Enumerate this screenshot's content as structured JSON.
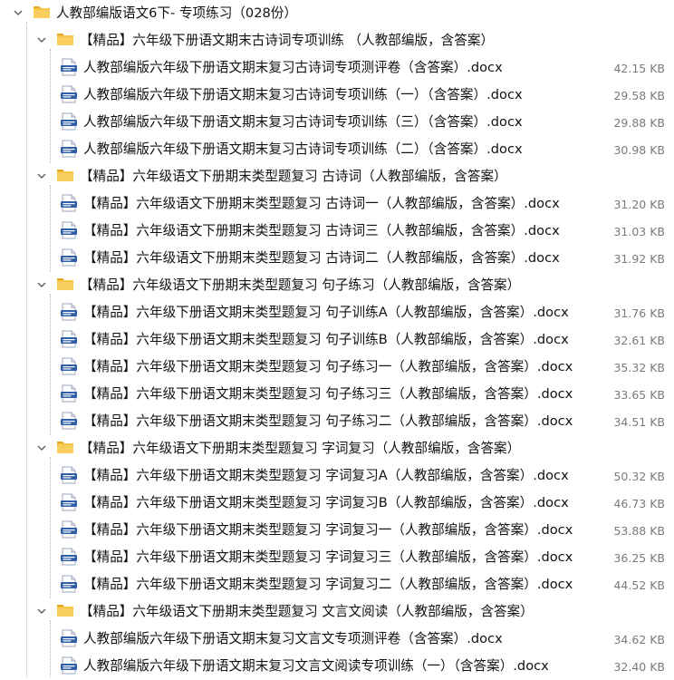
{
  "root": {
    "label": "人教部编版语文6下- 专项练习（028份）"
  },
  "groups": [
    {
      "label": "【精品】六年级下册语文期末古诗词专项训练 （人教部编版，含答案）",
      "files": [
        {
          "name": "人教部编版六年级下册语文期末复习古诗词专项测评卷（含答案）.docx",
          "size": "42.15 KB"
        },
        {
          "name": "人教部编版六年级下册语文期末复习古诗词专项训练（一）（含答案）.docx",
          "size": "29.58 KB"
        },
        {
          "name": "人教部编版六年级下册语文期末复习古诗词专项训练（三）（含答案）.docx",
          "size": "29.88 KB"
        },
        {
          "name": "人教部编版六年级下册语文期末复习古诗词专项训练（二）（含答案）.docx",
          "size": "30.98 KB"
        }
      ]
    },
    {
      "label": "【精品】六年级语文下册期末类型题复习 古诗词（人教部编版，含答案）",
      "files": [
        {
          "name": "【精品】六年级语文下册期末类型题复习 古诗词一（人教部编版，含答案）.docx",
          "size": "31.20 KB"
        },
        {
          "name": "【精品】六年级语文下册期末类型题复习 古诗词三（人教部编版，含答案）.docx",
          "size": "31.03 KB"
        },
        {
          "name": "【精品】六年级语文下册期末类型题复习 古诗词二（人教部编版，含答案）.docx",
          "size": "31.92 KB"
        }
      ]
    },
    {
      "label": "【精品】六年级语文下册期末类型题复习 句子练习（人教部编版，含答案）",
      "files": [
        {
          "name": "【精品】六年级下册语文期末类型题复习 句子训练A（人教部编版，含答案）.docx",
          "size": "31.76 KB"
        },
        {
          "name": "【精品】六年级下册语文期末类型题复习 句子训练B（人教部编版，含答案）.docx",
          "size": "32.61 KB"
        },
        {
          "name": "【精品】六年级下册语文期末类型题复习 句子练习一（人教部编版，含答案）.docx",
          "size": "35.32 KB"
        },
        {
          "name": "【精品】六年级下册语文期末类型题复习 句子练习三（人教部编版，含答案）.docx",
          "size": "33.65 KB"
        },
        {
          "name": "【精品】六年级下册语文期末类型题复习 句子练习二（人教部编版，含答案）.docx",
          "size": "34.51 KB"
        }
      ]
    },
    {
      "label": "【精品】六年级语文下册期末类型题复习 字词复习（人教部编版，含答案）",
      "files": [
        {
          "name": "【精品】六年级下册语文期末类型题复习 字词复习A（人教部编版，含答案）.docx",
          "size": "50.32 KB"
        },
        {
          "name": "【精品】六年级下册语文期末类型题复习 字词复习B（人教部编版，含答案）.docx",
          "size": "46.73 KB"
        },
        {
          "name": "【精品】六年级下册语文期末类型题复习 字词复习一（人教部编版，含答案）.docx",
          "size": "53.88 KB"
        },
        {
          "name": "【精品】六年级下册语文期末类型题复习 字词复习三（人教部编版，含答案）.docx",
          "size": "36.25 KB"
        },
        {
          "name": "【精品】六年级下册语文期末类型题复习 字词复习二（人教部编版，含答案）.docx",
          "size": "44.52 KB"
        }
      ]
    },
    {
      "label": "【精品】六年级语文下册期末类型题复习 文言文阅读（人教部编版，含答案）",
      "files": [
        {
          "name": "人教部编版六年级下册语文期末复习文言文专项测评卷（含答案）.docx",
          "size": "34.62 KB"
        },
        {
          "name": "人教部编版六年级下册语文期末复习文言文阅读专项训练（一）（含答案）.docx",
          "size": "32.40 KB"
        }
      ]
    }
  ],
  "icons": {
    "chevron": "chevron-down-icon",
    "folder": "folder-icon",
    "document": "docx-file-icon"
  },
  "colors": {
    "folder_body": "#f6c54a",
    "folder_tab": "#e8a920",
    "doc_blue": "#2f5fa8",
    "size_text": "#7a7a7a"
  }
}
